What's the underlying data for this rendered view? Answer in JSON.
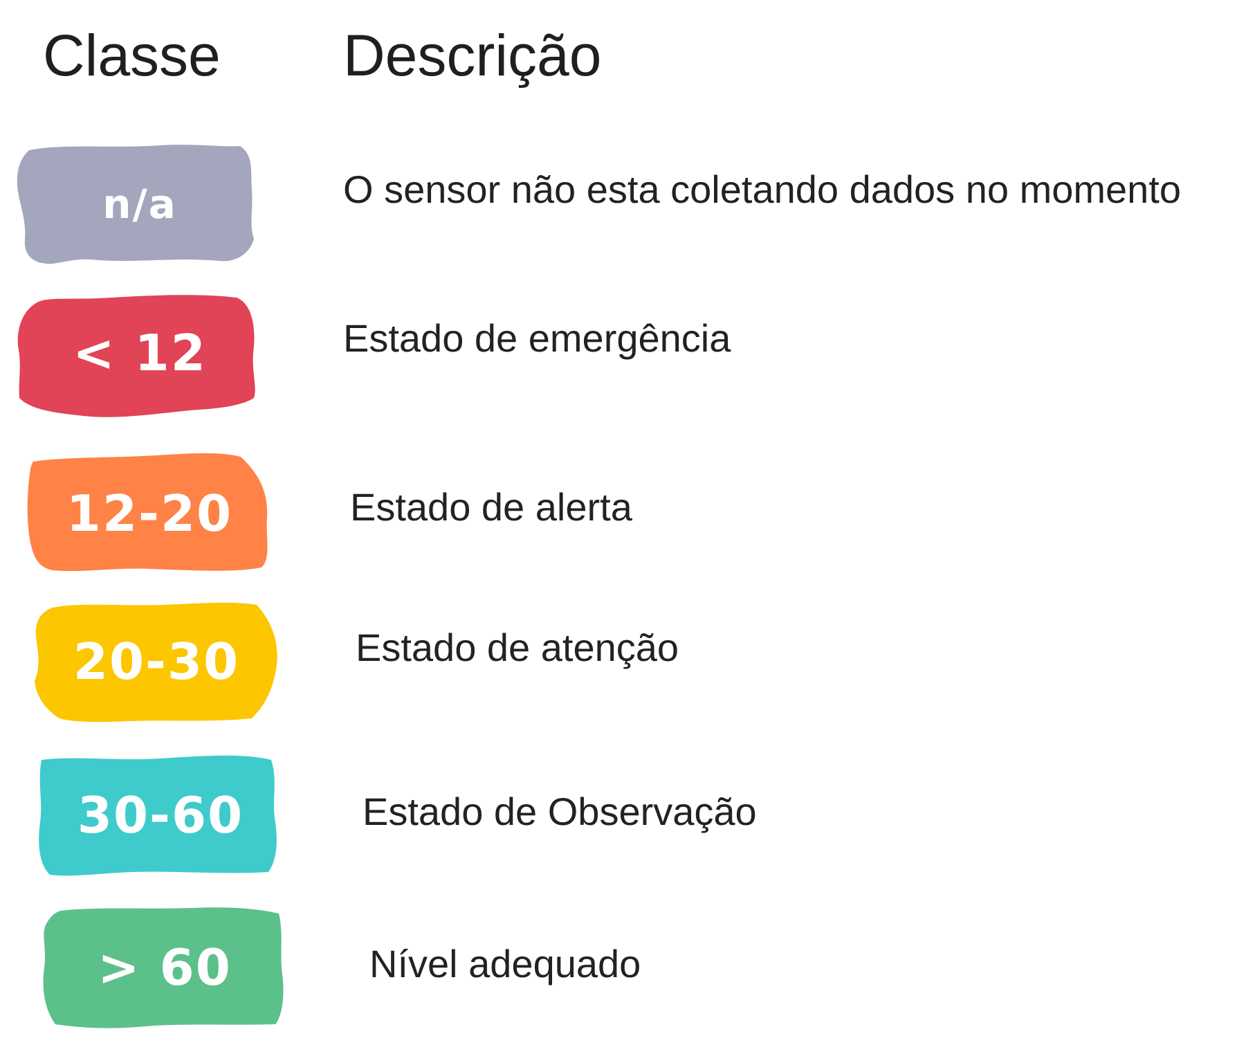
{
  "header": {
    "class_label": "Classe",
    "description_label": "Descrição"
  },
  "rows": [
    {
      "badge": "n/a",
      "color": "#A3A6BC",
      "description": "O sensor não esta coletando dados no momento"
    },
    {
      "badge": "< 12",
      "color": "#E04456",
      "description": "Estado de emergência"
    },
    {
      "badge": "12-20",
      "color": "#FF8246",
      "description": "Estado de alerta"
    },
    {
      "badge": "20-30",
      "color": "#FCC600",
      "description": "Estado de atenção"
    },
    {
      "badge": "30-60",
      "color": "#3FCBCB",
      "description": "Estado de Observação"
    },
    {
      "badge": "> 60",
      "color": "#5CC08A",
      "description": "Nível adequado"
    }
  ]
}
